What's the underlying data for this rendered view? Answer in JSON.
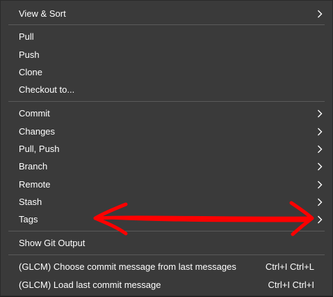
{
  "menu": {
    "items": [
      {
        "label": "View & Sort",
        "submenu": true
      },
      {
        "label": "Pull"
      },
      {
        "label": "Push"
      },
      {
        "label": "Clone"
      },
      {
        "label": "Checkout to..."
      },
      {
        "label": "Commit",
        "submenu": true
      },
      {
        "label": "Changes",
        "submenu": true
      },
      {
        "label": "Pull, Push",
        "submenu": true
      },
      {
        "label": "Branch",
        "submenu": true
      },
      {
        "label": "Remote",
        "submenu": true
      },
      {
        "label": "Stash",
        "submenu": true
      },
      {
        "label": "Tags",
        "submenu": true
      },
      {
        "label": "Show Git Output"
      },
      {
        "label": "(GLCM) Choose commit message from last messages",
        "shortcut": "Ctrl+I Ctrl+L"
      },
      {
        "label": "(GLCM) Load last commit message",
        "shortcut": "Ctrl+I Ctrl+I"
      }
    ]
  },
  "colors": {
    "menu_background": "#3a3a3a",
    "separator": "#5a5a5a",
    "text": "#ffffff",
    "annotation_arrow": "#ff0000"
  },
  "annotation": {
    "type": "double-headed arrow",
    "points_to": "Tags submenu chevron"
  }
}
